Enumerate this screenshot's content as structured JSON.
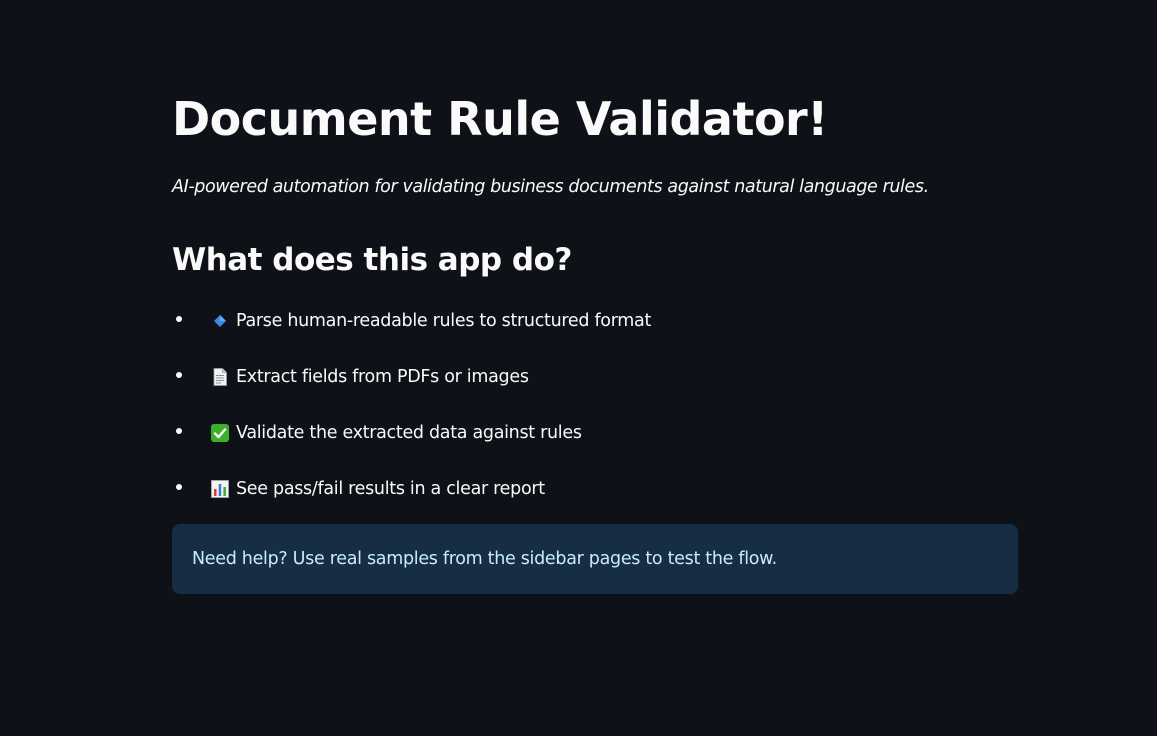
{
  "page": {
    "title": "Document Rule Validator!",
    "subtitle": "AI-powered automation for validating business documents against natural language rules.",
    "section_heading": "What does this app do?"
  },
  "features": [
    {
      "icon": "blue-diamond-icon",
      "text": "Parse human-readable rules to structured format"
    },
    {
      "icon": "page-document-icon",
      "text": "Extract fields from PDFs or images"
    },
    {
      "icon": "check-mark-button-icon",
      "text": "Validate the extracted data against rules"
    },
    {
      "icon": "bar-chart-icon",
      "text": "See pass/fail results in a clear report"
    }
  ],
  "info": {
    "text": "Need help? Use real samples from the sidebar pages to test the flow."
  },
  "colors": {
    "background": "#0e1117",
    "text": "#fafafa",
    "info_background": "#172d43",
    "info_text": "#c7ebff"
  }
}
